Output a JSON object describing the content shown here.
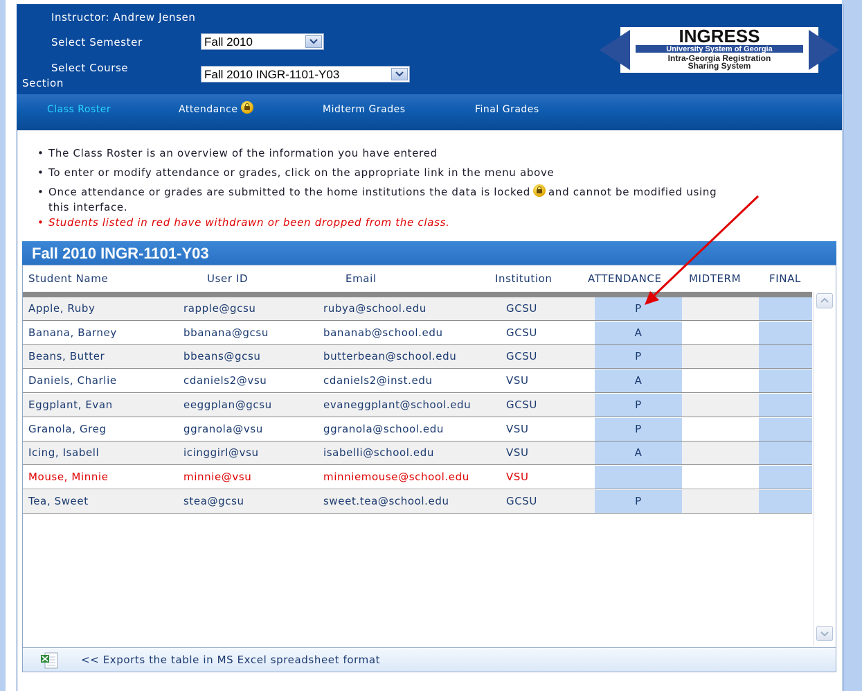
{
  "header": {
    "instructor_text": "Instructor: Andrew Jensen",
    "semester_label": "Select Semester",
    "semester_value": "Fall 2010",
    "course_label_line1": "Select Course",
    "course_label_line2": "Section",
    "course_value": "Fall 2010 INGR-1101-Y03"
  },
  "logo": {
    "title": "INGRESS",
    "line1": "University System of Georgia",
    "line2": "Intra-Georgia Registration",
    "line3": "Sharing System"
  },
  "nav": {
    "class_roster": "Class Roster",
    "attendance": "Attendance",
    "midterm": "Midterm Grades",
    "final": "Final Grades"
  },
  "info": {
    "bullet1": "The Class Roster is an overview of the information you have entered",
    "bullet2": "To enter or modify attendance or grades, click on the appropriate link in the menu above",
    "bullet3_part1": "Once attendance or grades are submitted to the home institutions the data is locked",
    "bullet3_part2": "and cannot be modified using",
    "bullet3_part3": "this interface.",
    "bullet4": "Students listed in red have withdrawn or been dropped from the class."
  },
  "grid": {
    "title": "Fall 2010 INGR-1101-Y03",
    "columns": {
      "name": "Student Name",
      "user_id": "User ID",
      "email": "Email",
      "institution": "Institution",
      "attendance": "ATTENDANCE",
      "midterm": "MIDTERM",
      "final": "FINAL"
    },
    "rows": [
      {
        "name": "Apple, Ruby",
        "user_id": "rapple@gcsu",
        "email": "rubya@school.edu",
        "institution": "GCSU",
        "attendance": "P"
      },
      {
        "name": "Banana, Barney",
        "user_id": "bbanana@gcsu",
        "email": "bananab@school.edu",
        "institution": "GCSU",
        "attendance": "A"
      },
      {
        "name": "Beans, Butter",
        "user_id": "bbeans@gcsu",
        "email": "butterbean@school.edu",
        "institution": "GCSU",
        "attendance": "P"
      },
      {
        "name": "Daniels, Charlie",
        "user_id": "cdaniels2@vsu",
        "email": "cdaniels2@inst.edu",
        "institution": "VSU",
        "attendance": "A"
      },
      {
        "name": "Eggplant, Evan",
        "user_id": "eeggplan@gcsu",
        "email": "evaneggplant@school.edu",
        "institution": "GCSU",
        "attendance": "P"
      },
      {
        "name": "Granola, Greg",
        "user_id": "ggranola@vsu",
        "email": "ggranola@school.edu",
        "institution": "VSU",
        "attendance": "P"
      },
      {
        "name": "Icing, Isabell",
        "user_id": "icinggirl@vsu",
        "email": "isabelli@school.edu",
        "institution": "VSU",
        "attendance": "A"
      },
      {
        "name": "Mouse, Minnie",
        "user_id": "minnie@vsu",
        "email": "minniemouse@school.edu",
        "institution": "VSU",
        "attendance": "",
        "withdrawn": true
      },
      {
        "name": "Tea, Sweet",
        "user_id": "stea@gcsu",
        "email": "sweet.tea@school.edu",
        "institution": "GCSU",
        "attendance": "P"
      }
    ]
  },
  "export": {
    "text": "<< Exports the table in MS Excel spreadsheet format"
  },
  "colors": {
    "header_bg": "#0a4a9c",
    "active_nav": "#27d5ff",
    "withdrawn": "#e00000",
    "annotation_arrow": "#e00000"
  }
}
